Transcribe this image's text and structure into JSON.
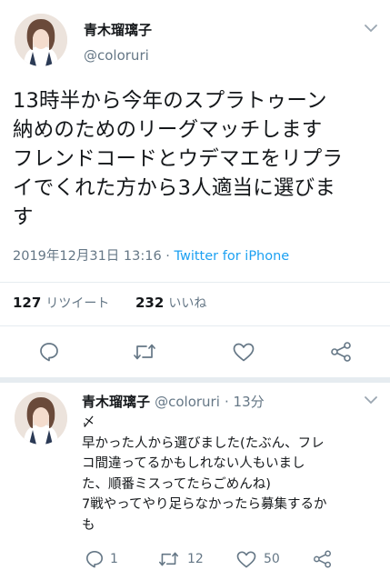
{
  "main_tweet": {
    "author_name": "青木瑠璃子",
    "author_handle": "@coloruri",
    "text": "13時半から今年のスプラトゥーン\n納めのためのリーグマッチします\nフレンドコードとウデマエをリプラ\nイでくれた方から3人適当に選びま\nす",
    "timestamp": "2019年12月31日 13:16",
    "separator": " · ",
    "client": "Twitter for iPhone",
    "retweet_count": "127",
    "retweet_label": "リツイート",
    "like_count": "232",
    "like_label": "いいね"
  },
  "reply_tweet": {
    "author_name": "青木瑠璃子",
    "author_handle": "@coloruri",
    "time_ago": "· 13分",
    "text": "〆\n早かった人から選びました(たぶん、フレ\nコ間違ってるかもしれない人もいまし\nた、順番ミスってたらごめんね)\n7戦やってやり足らなかったら募集するか\nも",
    "reply_count": "1",
    "retweet_count": "12",
    "like_count": "50"
  },
  "icons": [
    "chevron-down-icon",
    "reply-icon",
    "retweet-icon",
    "like-icon",
    "share-icon"
  ],
  "colors": {
    "link": "#1da1f2",
    "secondary_text": "#657786",
    "divider": "#e6ecf0"
  }
}
